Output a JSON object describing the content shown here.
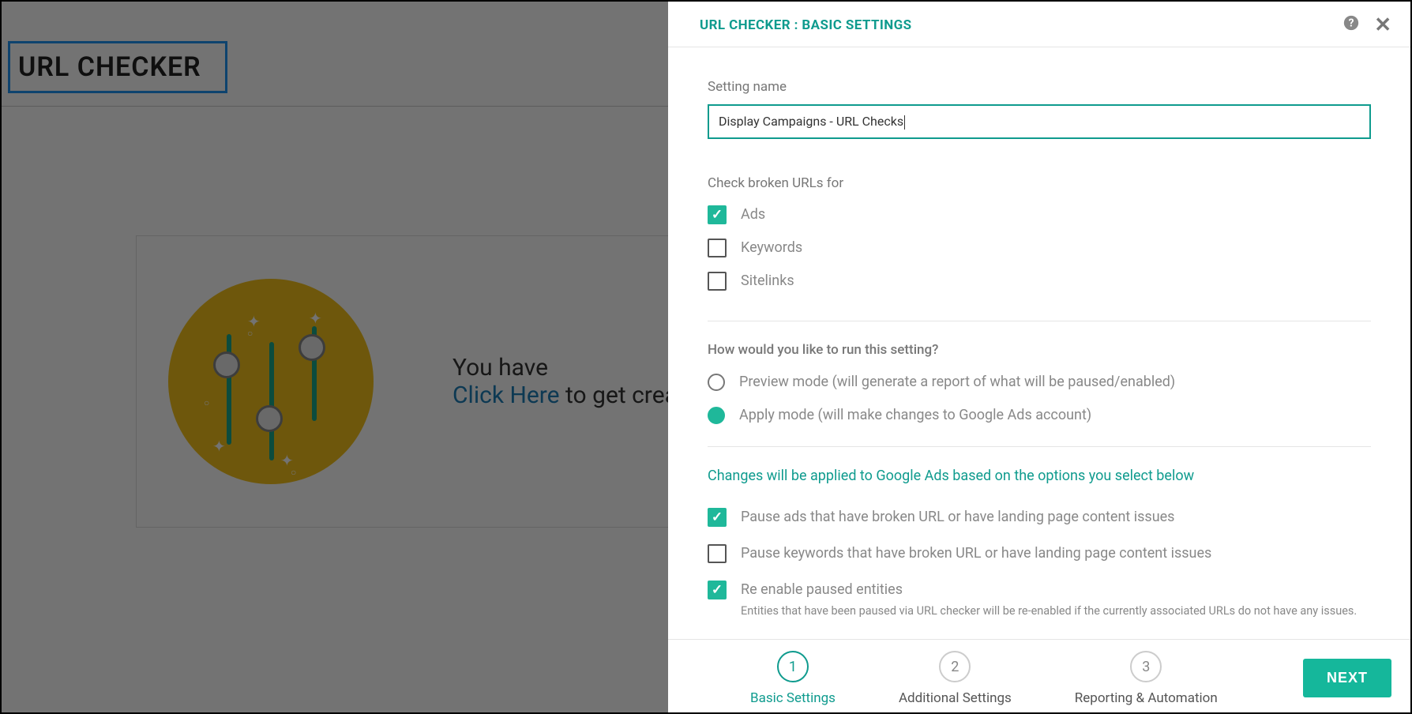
{
  "bg": {
    "title": "URL CHECKER",
    "empty_line1": "You have ",
    "empty_link": "Click Here",
    "empty_line2": " to get crea"
  },
  "panel": {
    "title": "URL CHECKER : BASIC SETTINGS",
    "setting_name_label": "Setting name",
    "setting_name_value": "Display Campaigns - URL Checks",
    "check_for_label": "Check broken URLs for",
    "check_for": [
      {
        "label": "Ads",
        "checked": true
      },
      {
        "label": "Keywords",
        "checked": false
      },
      {
        "label": "Sitelinks",
        "checked": false
      }
    ],
    "run_mode_label": "How would you like to run this setting?",
    "run_modes": [
      {
        "label": "Preview mode (will generate a report of what will be paused/enabled)",
        "selected": false
      },
      {
        "label": "Apply mode (will make changes to Google Ads account)",
        "selected": true
      }
    ],
    "info": "Changes will be applied to Google Ads based on the options you select below",
    "apply_options": [
      {
        "label": "Pause ads that have broken URL or have landing page content issues",
        "checked": true,
        "note": null
      },
      {
        "label": "Pause keywords that have broken URL or have landing page content issues",
        "checked": false,
        "note": null
      },
      {
        "label": "Re enable paused entities",
        "checked": true,
        "note": "Entities that have been paused via URL checker will be re-enabled if the currently associated URLs do not have any issues."
      }
    ],
    "steps": [
      {
        "num": "1",
        "label": "Basic Settings",
        "active": true
      },
      {
        "num": "2",
        "label": "Additional Settings",
        "active": false
      },
      {
        "num": "3",
        "label": "Reporting & Automation",
        "active": false
      }
    ],
    "next": "NEXT"
  }
}
